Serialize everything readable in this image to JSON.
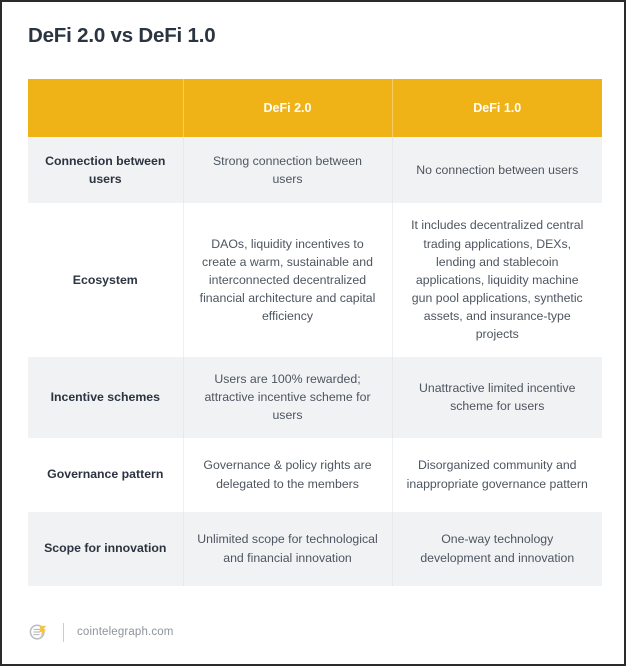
{
  "page": {
    "title": "DeFi 2.0 vs DeFi 1.0",
    "accent_color": "#efb217",
    "title_color": "#2b3440",
    "row_shade_color": "#f1f2f3",
    "border_color": "#2b2b2b"
  },
  "table": {
    "headers": {
      "blank": "",
      "col2": "DeFi 2.0",
      "col3": "DeFi 1.0"
    },
    "rows": [
      {
        "label": "Connection between users",
        "defi2": "Strong connection between users",
        "defi1": "No connection between users"
      },
      {
        "label": "Ecosystem",
        "defi2": "DAOs, liquidity incentives to create a warm, sustainable and interconnected decentralized financial architecture and capital efficiency",
        "defi1": "It includes decentralized central trading applications, DEXs, lending and stablecoin applications, liquidity machine gun pool applications, synthetic assets, and insurance-type projects"
      },
      {
        "label": "Incentive schemes",
        "defi2": "Users are 100% rewarded; attractive incentive scheme for users",
        "defi1": "Unattractive limited incentive scheme for users"
      },
      {
        "label": "Governance pattern",
        "defi2": "Governance & policy rights are delegated to the members",
        "defi1": "Disorganized community and inappropriate governance pattern"
      },
      {
        "label": "Scope for innovation",
        "defi2": "Unlimited scope for technological and financial innovation",
        "defi1": "One-way technology development and innovation"
      }
    ]
  },
  "footer": {
    "logo_icon": "cointelegraph-logo-icon",
    "site": "cointelegraph.com"
  }
}
